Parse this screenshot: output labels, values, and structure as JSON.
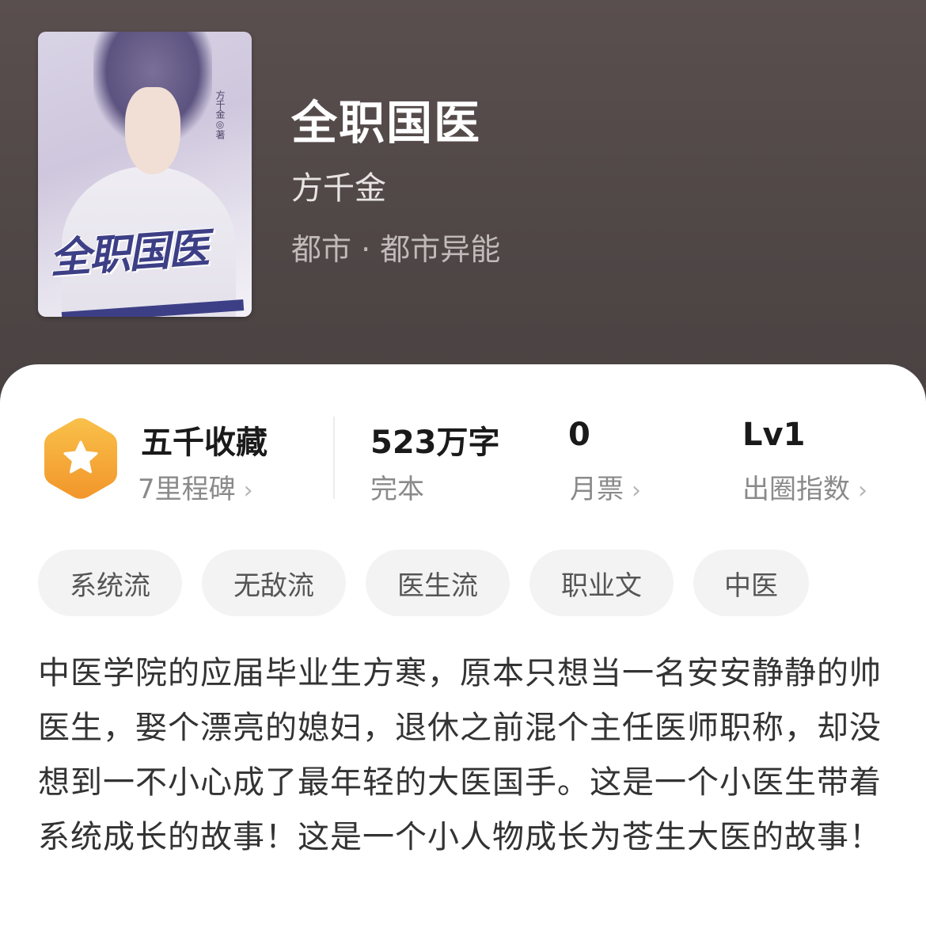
{
  "book": {
    "title": "全职国医",
    "author": "方千金",
    "genre": "都市 · 都市异能",
    "cover": {
      "title": "全职国医",
      "vertical_text": "方千金◎著"
    }
  },
  "stats": {
    "collection": {
      "label": "五千收藏",
      "sub": "7里程碑",
      "icon": "star-hexagon-icon"
    },
    "words": {
      "label": "523万字",
      "sub": "完本"
    },
    "monthly_tickets": {
      "label": "0",
      "sub": "月票"
    },
    "influence": {
      "label": "Lv1",
      "sub": "出圈指数"
    }
  },
  "tags": [
    "系统流",
    "无敌流",
    "医生流",
    "职业文",
    "中医"
  ],
  "synopsis": "中医学院的应届毕业生方寒，原本只想当一名安安静静的帅医生，娶个漂亮的媳妇，退休之前混个主任医师职称，却没想到一不小心成了最年轻的大医国手。这是一个小医生带着系统成长的故事！这是一个小人物成长为苍生大医的故事！",
  "colors": {
    "header_bg": "#4f4646",
    "badge_orange": "#f5a623",
    "tag_bg": "#f3f3f3"
  }
}
